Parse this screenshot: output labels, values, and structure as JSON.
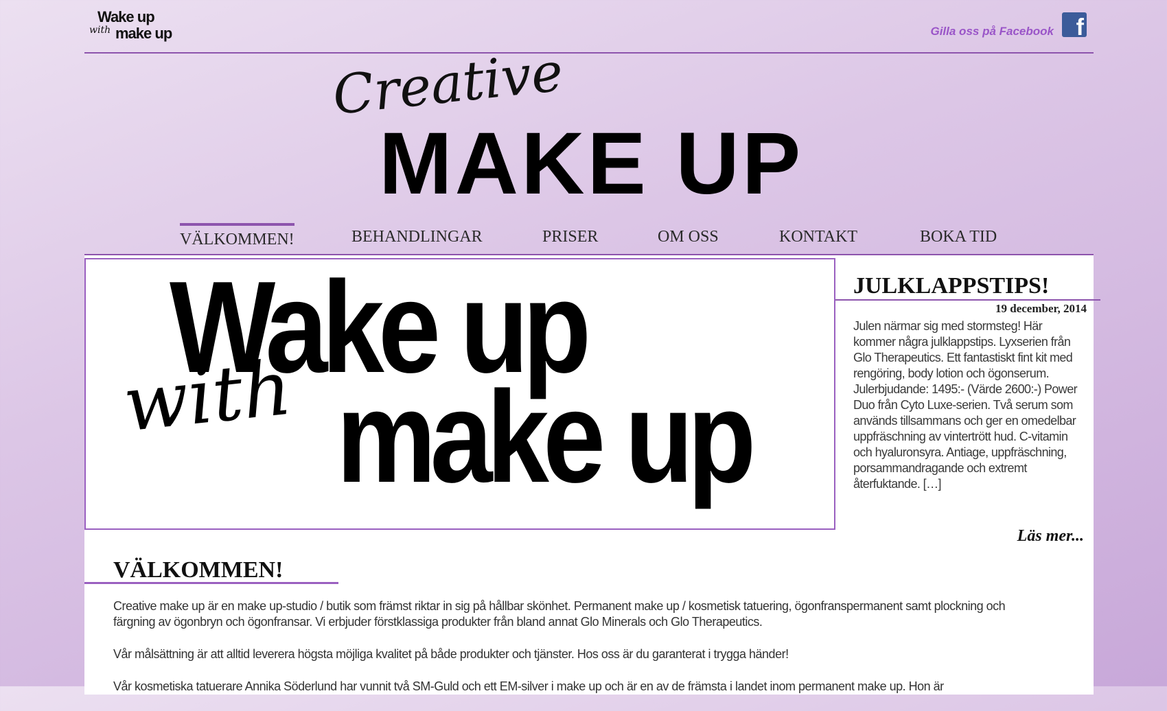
{
  "header": {
    "logo_line1": "Wake up",
    "logo_line2": "with",
    "logo_line3": "make up",
    "facebook_label": "Gilla oss på Facebook",
    "facebook_icon": "f"
  },
  "hero": {
    "creative": "Creative",
    "makeup": "MAKE UP"
  },
  "nav": {
    "items": [
      "VÄLKOMMEN!",
      "BEHANDLINGAR",
      "PRISER",
      "OM OSS",
      "KONTAKT",
      "BOKA TID"
    ],
    "active": 0
  },
  "banner": {
    "line1": "Wake up",
    "line2": "with",
    "line3": "make up"
  },
  "sidebar": {
    "title": "JULKLAPPSTIPS!",
    "date": "19 december, 2014",
    "text": "Julen närmar sig med stormsteg! Här kommer några julklappstips. Lyxserien från Glo Therapeutics. Ett fantastiskt fint kit med rengöring, body lotion och ögonserum. Julerbjudande: 1495:- (Värde 2600:-)      Power Duo från Cyto Luxe-serien. Två serum som används tillsammans och ger en omedelbar uppfräschning av vintertrött hud. C-vitamin och hyaluronsyra. Antiage, uppfräschning, porsammandragande och extremt återfuktande. […]",
    "more": "Läs mer..."
  },
  "welcome": {
    "title": "VÄLKOMMEN!",
    "p1": "Creative make up är en make up-studio / butik som främst riktar in sig på hållbar skönhet. Permanent make up / kosmetisk tatuering, ögonfranspermanent samt plockning och färgning av ögonbryn och ögonfransar. Vi erbjuder förstklassiga produkter från bland annat Glo Minerals och Glo Therapeutics.",
    "p2": "Vår målsättning är att alltid leverera högsta möjliga kvalitet på både produkter och tjänster. Hos oss är du garanterat i trygga händer!",
    "p3": "Vår kosmetiska tatuerare Annika Söderlund har vunnit två SM-Guld och ett EM-silver i make up och är en av de främsta i landet inom permanent make up. Hon är"
  },
  "colors": {
    "accent": "#8d54ad",
    "facebook_text": "#9a55c8",
    "facebook_blue": "#3b5b9a"
  }
}
